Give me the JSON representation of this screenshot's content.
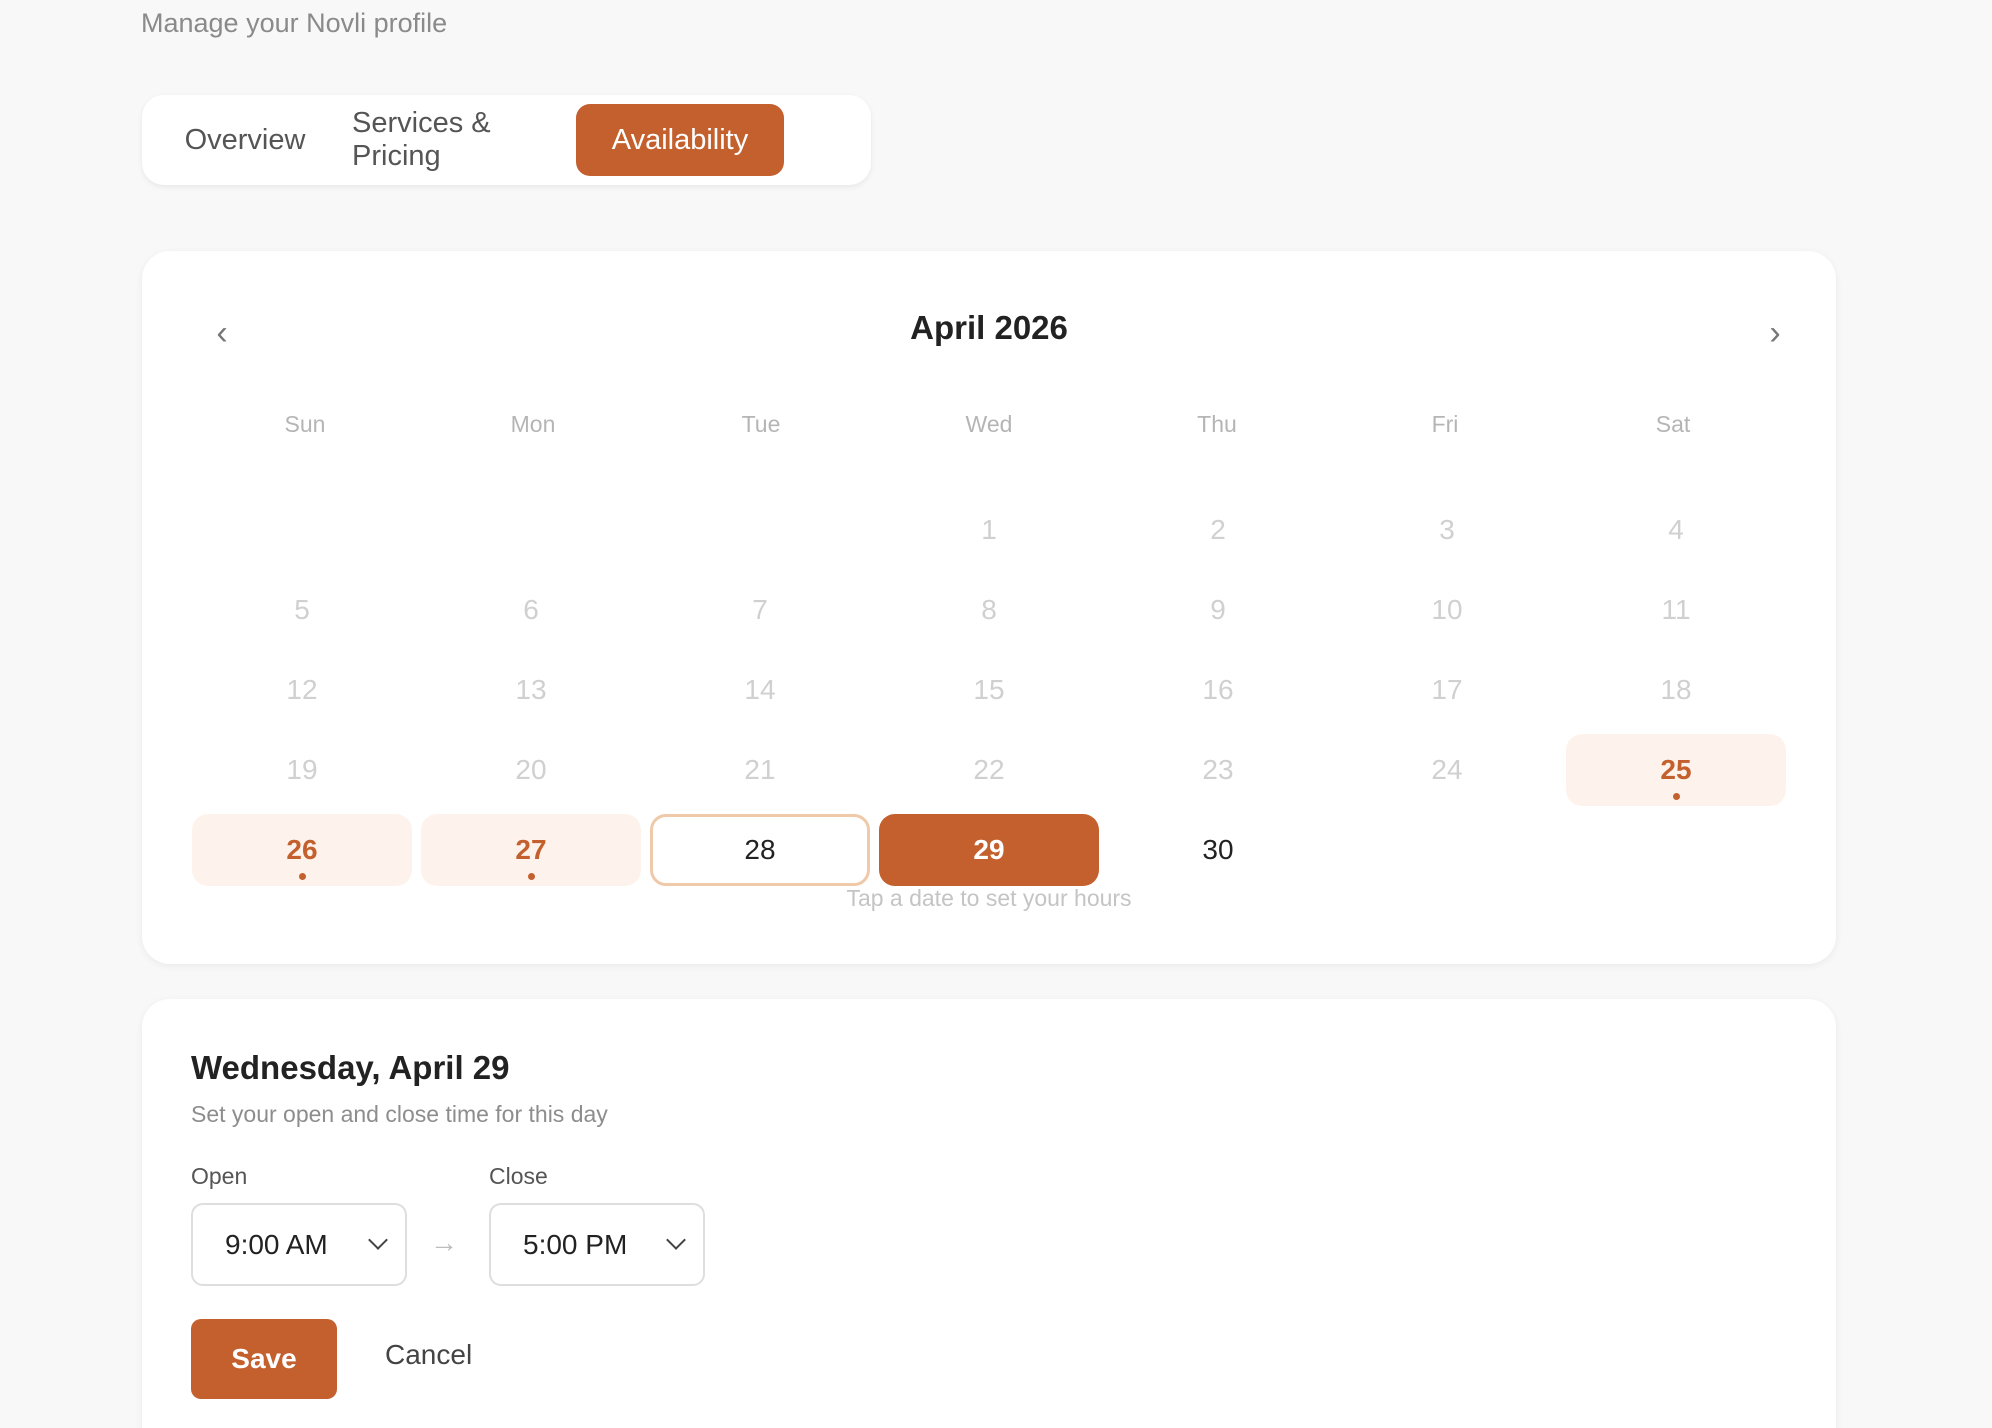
{
  "header": {
    "subtitle": "Manage your Novli profile"
  },
  "tabs": [
    {
      "label": "Overview",
      "active": false
    },
    {
      "label": "Services & Pricing",
      "active": false
    },
    {
      "label": "Availability",
      "active": true
    }
  ],
  "calendar": {
    "prev_glyph": "‹",
    "next_glyph": "›",
    "month_title": "April 2026",
    "weekdays": [
      "Sun",
      "Mon",
      "Tue",
      "Wed",
      "Thu",
      "Fri",
      "Sat"
    ],
    "first_weekday_index": 3,
    "days": [
      {
        "n": "1",
        "state": "past"
      },
      {
        "n": "2",
        "state": "past"
      },
      {
        "n": "3",
        "state": "past"
      },
      {
        "n": "4",
        "state": "past"
      },
      {
        "n": "5",
        "state": "past"
      },
      {
        "n": "6",
        "state": "past"
      },
      {
        "n": "7",
        "state": "past"
      },
      {
        "n": "8",
        "state": "past"
      },
      {
        "n": "9",
        "state": "past"
      },
      {
        "n": "10",
        "state": "past"
      },
      {
        "n": "11",
        "state": "past"
      },
      {
        "n": "12",
        "state": "past"
      },
      {
        "n": "13",
        "state": "past"
      },
      {
        "n": "14",
        "state": "past"
      },
      {
        "n": "15",
        "state": "past"
      },
      {
        "n": "16",
        "state": "past"
      },
      {
        "n": "17",
        "state": "past"
      },
      {
        "n": "18",
        "state": "past"
      },
      {
        "n": "19",
        "state": "past"
      },
      {
        "n": "20",
        "state": "past"
      },
      {
        "n": "21",
        "state": "past"
      },
      {
        "n": "22",
        "state": "past"
      },
      {
        "n": "23",
        "state": "past"
      },
      {
        "n": "24",
        "state": "past"
      },
      {
        "n": "25",
        "state": "booked"
      },
      {
        "n": "26",
        "state": "booked"
      },
      {
        "n": "27",
        "state": "booked"
      },
      {
        "n": "28",
        "state": "today"
      },
      {
        "n": "29",
        "state": "selected"
      },
      {
        "n": "30",
        "state": "available"
      }
    ],
    "hint": "Tap a date to set your hours"
  },
  "day_panel": {
    "title": "Wednesday, April 29",
    "subtitle": "Set your open and close time for this day",
    "open_label": "Open",
    "open_value": "9:00 AM",
    "arrow": "→",
    "close_label": "Close",
    "close_value": "5:00 PM",
    "save_label": "Save",
    "cancel_label": "Cancel"
  },
  "colors": {
    "accent": "#c4602d",
    "accent_soft": "#fdf3ec",
    "today_border": "#f0c9a8"
  }
}
